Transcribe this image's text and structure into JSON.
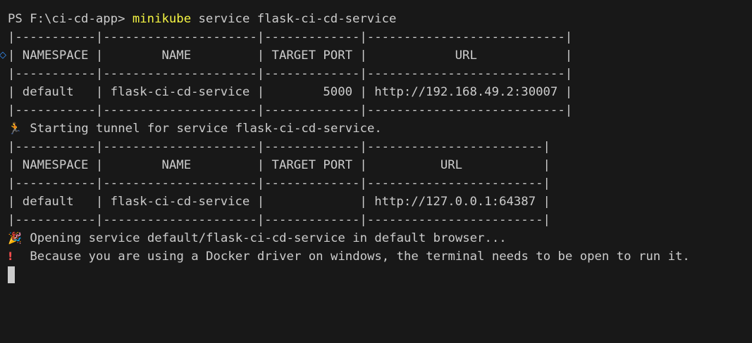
{
  "prompt": {
    "text": "PS F:\\ci-cd-app> ",
    "command": "minikube",
    "args": " service flask-ci-cd-service"
  },
  "table1": {
    "sep": "|-----------|---------------------|-------------|---------------------------|",
    "header": "| NAMESPACE |        NAME         | TARGET PORT |            URL            |",
    "row": "| default   | flask-ci-cd-service |        5000 | http://192.168.49.2:30007 |"
  },
  "tunnel": {
    "icon": "running-person-icon",
    "text": "Starting tunnel for service flask-ci-cd-service."
  },
  "table2": {
    "sep": "|-----------|---------------------|-------------|------------------------|",
    "header": "| NAMESPACE |        NAME         | TARGET PORT |          URL           |",
    "row": "| default   | flask-ci-cd-service |             | http://127.0.0.1:64387 |"
  },
  "opening": {
    "icon": "party-popper-icon",
    "text": "Opening service default/flask-ci-cd-service in default browser..."
  },
  "warning": {
    "icon": "exclamation-icon",
    "text": "Because you are using a Docker driver on windows, the terminal needs to be open to run it."
  },
  "colors": {
    "background": "#181818",
    "foreground": "#cccccc",
    "command": "#f5f543",
    "warning": "#f14c4c"
  }
}
